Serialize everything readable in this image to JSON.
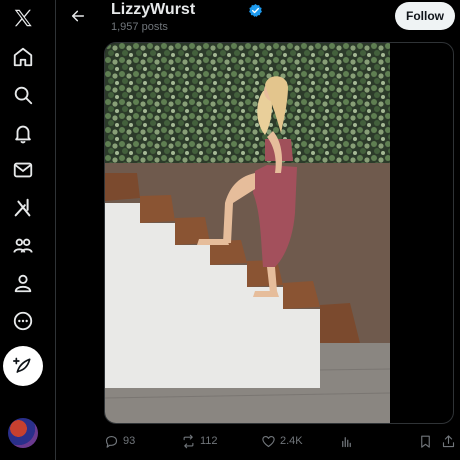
{
  "profile": {
    "name": "LizzyWurst",
    "post_count": "1,957 posts",
    "follow_label": "Follow"
  },
  "sidebar": {
    "items": [
      {
        "icon": "x-logo-icon"
      },
      {
        "icon": "home-icon"
      },
      {
        "icon": "search-icon"
      },
      {
        "icon": "notifications-bell-icon"
      },
      {
        "icon": "messages-envelope-icon"
      },
      {
        "icon": "grok-icon"
      },
      {
        "icon": "communities-icon"
      },
      {
        "icon": "profile-person-icon"
      },
      {
        "icon": "more-circle-icon"
      },
      {
        "icon": "compose-post-icon"
      }
    ]
  },
  "actions": {
    "replies": "93",
    "reposts": "112",
    "likes": "2.4K"
  },
  "colors": {
    "background": "#000000",
    "verified_badge": "#1d9bf0",
    "muted_text": "#71767b",
    "follow_button": "#eff3f4"
  }
}
